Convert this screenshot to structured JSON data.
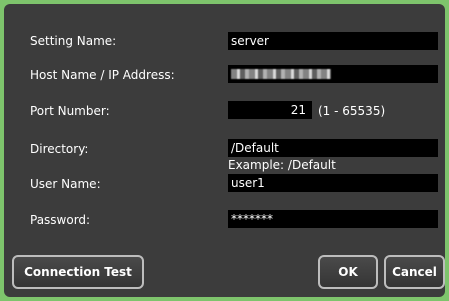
{
  "form": {
    "setting_name": {
      "label": "Setting Name:",
      "value": "server"
    },
    "host": {
      "label": "Host Name / IP Address:",
      "value": ""
    },
    "port": {
      "label": "Port Number:",
      "value": "21",
      "range": "(1 - 65535)"
    },
    "directory": {
      "label": "Directory:",
      "value": "/Default",
      "hint": "Example: /Default"
    },
    "user": {
      "label": "User Name:",
      "value": "user1"
    },
    "password": {
      "label": "Password:",
      "value": "*******"
    }
  },
  "buttons": {
    "connection_test": "Connection Test",
    "ok": "OK",
    "cancel": "Cancel"
  },
  "colors": {
    "outer_border": "#7ec46c",
    "panel": "#3c3c3c",
    "field": "#000000"
  }
}
